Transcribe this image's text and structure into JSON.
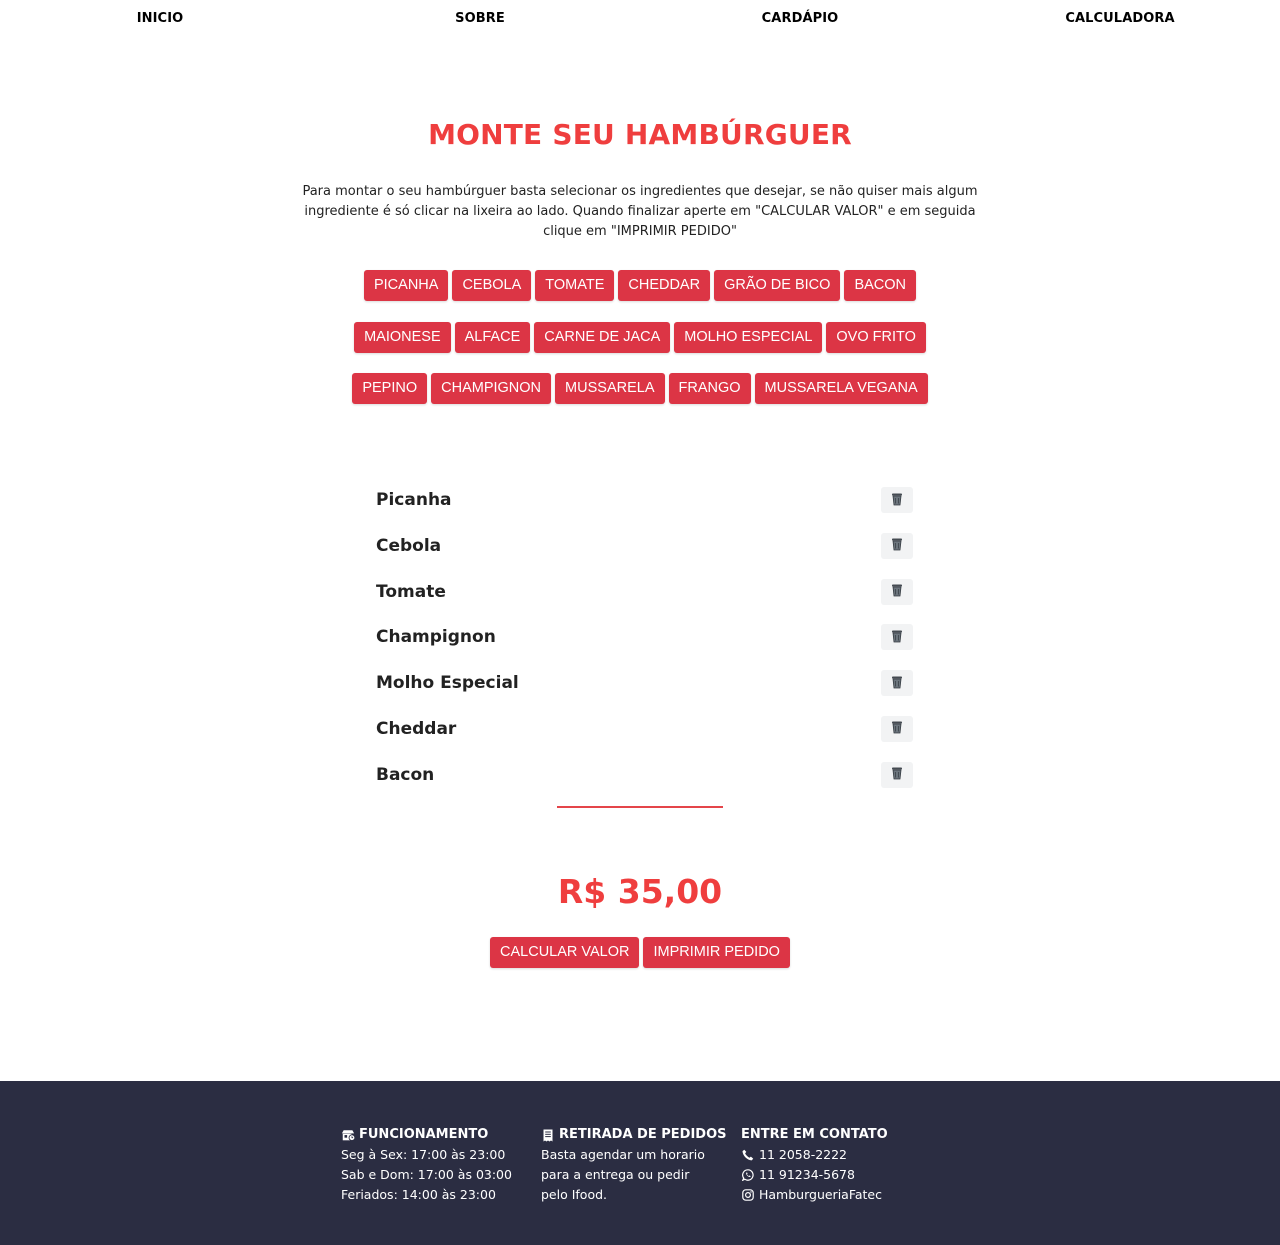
{
  "nav": {
    "items": [
      "INICIO",
      "SOBRE",
      "CARDÁPIO",
      "CALCULADORA"
    ]
  },
  "page": {
    "title": "MONTE SEU HAMBÚRGUER",
    "intro": "Para montar o seu hambúrguer basta selecionar os ingredientes que desejar, se não quiser mais algum ingrediente é só clicar na lixeira ao lado. Quando finalizar aperte em \"CALCULAR VALOR\" e em seguida clique em \"IMPRIMIR PEDIDO\""
  },
  "ingredient_buttons": [
    [
      "PICANHA",
      "CEBOLA",
      "TOMATE",
      "CHEDDAR",
      "GRÃO DE BICO",
      "BACON"
    ],
    [
      "MAIONESE",
      "ALFACE",
      "CARNE DE JACA",
      "MOLHO ESPECIAL",
      "OVO FRITO"
    ],
    [
      "PEPINO",
      "CHAMPIGNON",
      "MUSSARELA",
      "FRANGO",
      "MUSSARELA VEGANA"
    ]
  ],
  "selected_items": [
    "Picanha",
    "Cebola",
    "Tomate",
    "Champignon",
    "Molho Especial",
    "Cheddar",
    "Bacon"
  ],
  "selected_item_icon": "trash-icon",
  "total": "R$ 35,00",
  "actions": {
    "calculate": "CALCULAR VALOR",
    "print": "IMPRIMIR PEDIDO"
  },
  "footer": {
    "hours": {
      "icon": "shop-icon",
      "title": "FUNCIONAMENTO",
      "lines": [
        "Seg à Sex: 17:00 às 23:00",
        "Sab e Dom: 17:00 às 03:00",
        "Feriados: 14:00 às 23:00"
      ]
    },
    "pickup": {
      "icon": "receipt-icon",
      "title": "RETIRADA DE PEDIDOS",
      "lines": [
        "Basta agendar um horario",
        "para a entrega ou pedir",
        "pelo Ifood."
      ]
    },
    "contact": {
      "title": "ENTRE EM CONTATO",
      "phone": "11 2058-2222",
      "whatsapp": "11 91234-5678",
      "instagram": "HamburgueriaFatec"
    }
  },
  "colors": {
    "accent": "#dc3545",
    "title": "#ef3e3e",
    "footer_bg": "#2b2d42"
  }
}
